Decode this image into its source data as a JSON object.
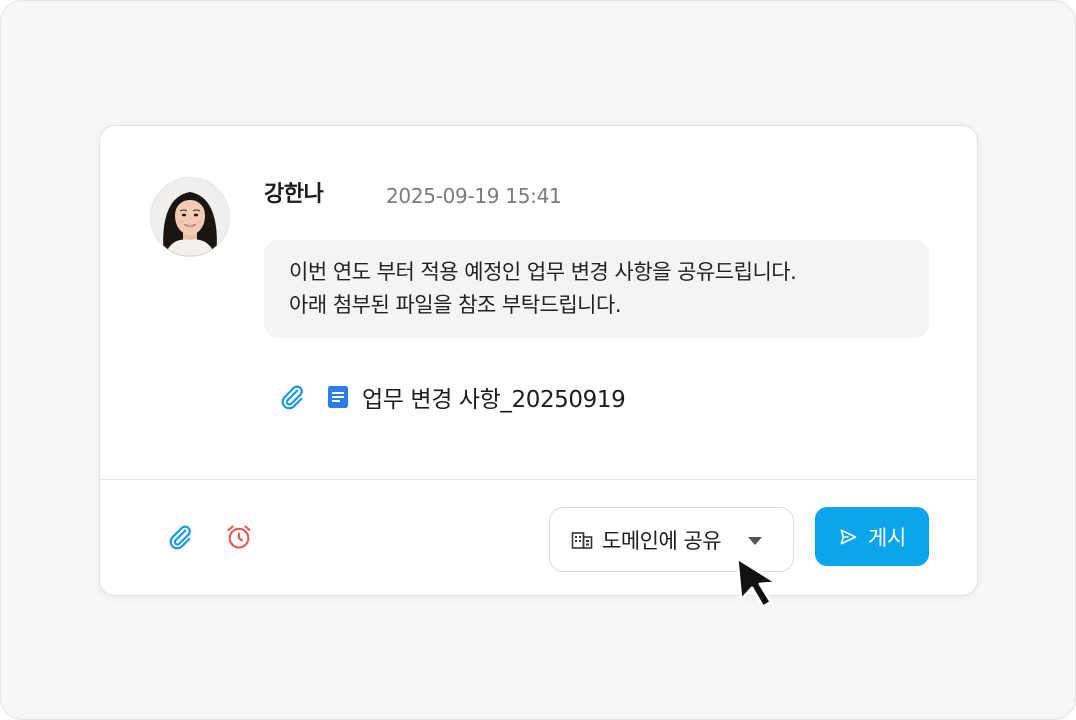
{
  "post": {
    "author": "강한나",
    "timestamp": "2025-09-19 15:41",
    "avatar_icon": "avatar-photo",
    "message_lines": [
      "이번 연도 부터 적용 예정인 업무 변경 사항을 공유드립니다.",
      "아래 첨부된 파일을 참조 부탁드립니다."
    ],
    "attachment": {
      "icon": "paperclip-icon",
      "file_icon": "document-icon",
      "name": "업무 변경 사항_20250919"
    }
  },
  "composer": {
    "tools": [
      {
        "name": "attach",
        "icon": "paperclip-icon",
        "color": "#1a9be0"
      },
      {
        "name": "reminder",
        "icon": "alarm-clock-icon",
        "color": "#e8584f"
      }
    ],
    "share": {
      "icon": "building-icon",
      "label": "도메인에 공유",
      "caret_icon": "caret-down-icon"
    },
    "post_button": {
      "icon": "send-icon",
      "label": "게시"
    }
  },
  "colors": {
    "accent": "#0aa5ea",
    "doc_icon": "#2b7de9",
    "clip_icon": "#1a9be0",
    "alarm_icon": "#e8584f",
    "bubble_bg": "#f4f4f4"
  }
}
